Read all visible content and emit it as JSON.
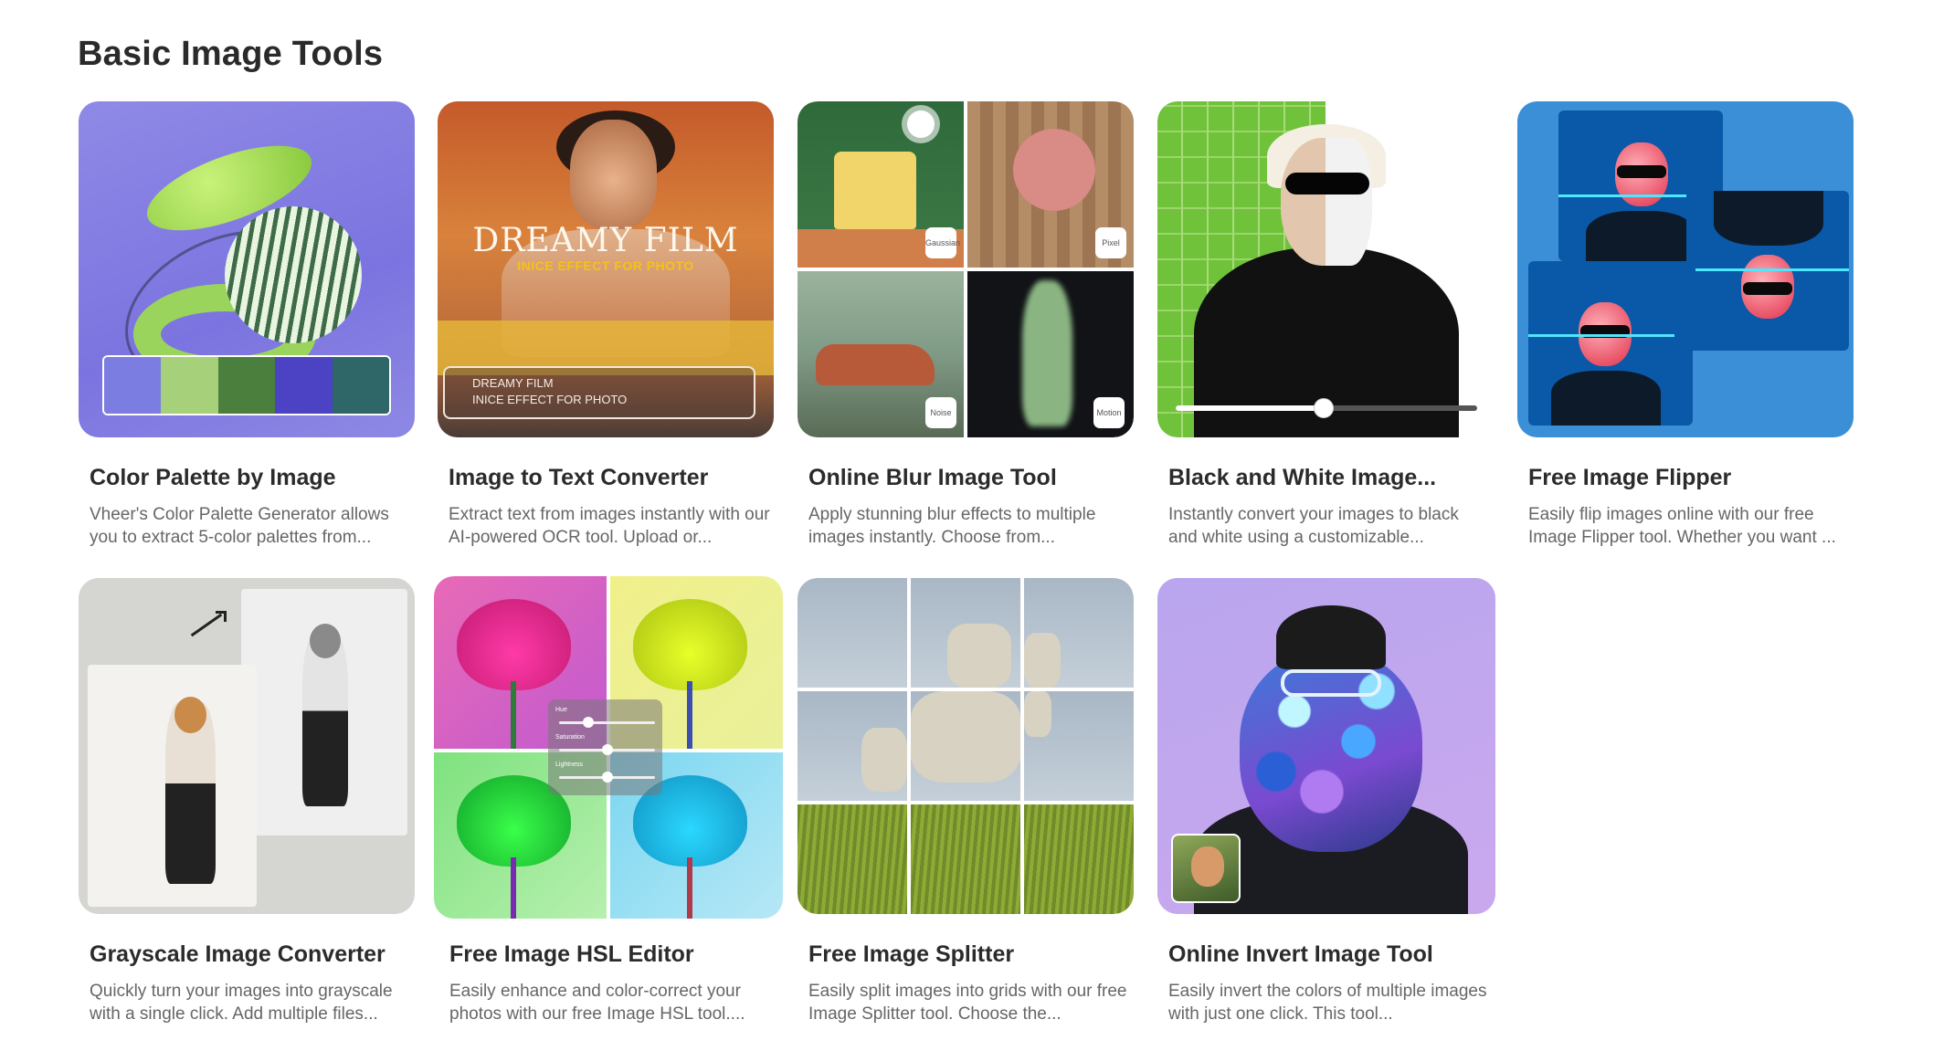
{
  "section": {
    "title": "Basic Image Tools"
  },
  "cards": [
    {
      "title": "Color Palette by Image",
      "desc": "Vheer's Color Palette Generator allows you to extract 5-color palettes from..."
    },
    {
      "title": "Image to Text Converter",
      "desc": "Extract text from images instantly with our AI-powered OCR tool. Upload or..."
    },
    {
      "title": "Online Blur Image Tool",
      "desc": "Apply stunning blur effects to multiple images instantly. Choose from..."
    },
    {
      "title": "Black and White Image...",
      "desc": "Instantly convert your images to black and white using a customizable..."
    },
    {
      "title": "Free Image Flipper",
      "desc": "Easily flip images online with our free Image Flipper tool. Whether you want ..."
    },
    {
      "title": "Grayscale Image Converter",
      "desc": "Quickly turn your images into grayscale with a single click. Add multiple files..."
    },
    {
      "title": "Free Image HSL Editor",
      "desc": "Easily enhance and color-correct your photos with our free Image HSL tool...."
    },
    {
      "title": "Free Image Splitter",
      "desc": "Easily split images into grids with our free Image Splitter tool. Choose the..."
    },
    {
      "title": "Online Invert Image Tool",
      "desc": "Easily invert the colors of multiple images with just one click. This tool..."
    }
  ],
  "thumbs": {
    "palette_colors": [
      "#7b7ee0",
      "#a6d07a",
      "#4a7f3e",
      "#4b42c4",
      "#2f6668"
    ],
    "film": {
      "title": "DREAMY FILM",
      "subtitle": "INICE EFFECT FOR PHOTO",
      "box_line1": "DREAMY FILM",
      "box_line2": "INICE EFFECT FOR PHOTO"
    },
    "blur_badges": [
      "Gaussian",
      "Pixel",
      "Noise",
      "Motion"
    ],
    "hsl_labels": [
      "Hue",
      "Saturation",
      "Lightness"
    ],
    "hsl_levels": [
      0.3,
      0.5,
      0.5
    ],
    "bw_slider_level": 0.49
  }
}
